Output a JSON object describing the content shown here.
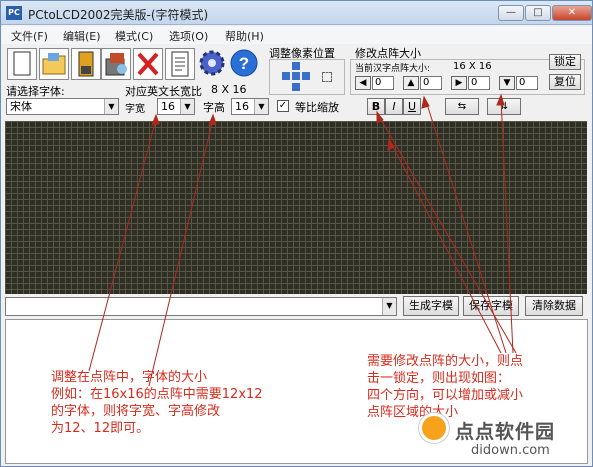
{
  "window": {
    "title": "PCtoLCD2002完美版-(字符模式)",
    "icon_text": "PC"
  },
  "menu": [
    "文件(F)",
    "编辑(E)",
    "模式(C)",
    "选项(O)",
    "帮助(H)"
  ],
  "toolbar": {
    "icons": [
      "new-file-icon",
      "open-folder-icon",
      "save-icon",
      "save-as-icon",
      "delete-icon",
      "document-icon",
      "gear-icon",
      "help-icon"
    ]
  },
  "font": {
    "select_label": "请选择字体:",
    "font_value": "宋体",
    "ratio_label": "对应英文长宽比",
    "ratio_value": "8 X 16",
    "width_label": "字宽",
    "width_value": "16",
    "height_label": "字高",
    "height_value": "16",
    "proportional_label": "等比缩放"
  },
  "pixel_adjust": {
    "label": "调整像素位置"
  },
  "matrix": {
    "label": "修改点阵大小",
    "current_label": "当前汉字点阵大小:",
    "current_value": "16 X 16",
    "lock_label": "锁定",
    "restore_label": "复位",
    "fields": [
      "0",
      "0",
      "0",
      "0"
    ]
  },
  "style_buttons": [
    "B",
    "I",
    "U"
  ],
  "bottom": {
    "generate_label": "生成字模",
    "save_label": "保存字模",
    "clear_label": "清除数据"
  },
  "annotations": {
    "left": "调整在点阵中，字体的大小\n例如：在16x16的点阵中需要12x12\n的字体，则将字宽、字高修改\n为12、12即可。",
    "right": "需要修改点阵的大小，则点\n击一锁定，则出现如图：\n四个方向，可以增加或减小\n点阵区域的大小"
  },
  "watermark": {
    "name": "点点软件园",
    "url": "didown.com"
  },
  "colors": {
    "grid_bg": "#2f2f24",
    "annotation": "#d92b1c",
    "titlebar": "#c4d6ec"
  }
}
